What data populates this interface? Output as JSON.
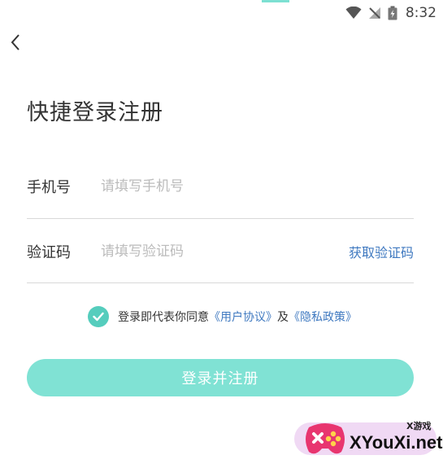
{
  "status_bar": {
    "time": "8:32",
    "icons": [
      "wifi-icon",
      "no-signal-icon",
      "battery-charging-icon"
    ],
    "accent_color": "#7de0d2"
  },
  "nav": {
    "back_icon": "chevron-left-icon"
  },
  "page": {
    "title": "快捷登录注册"
  },
  "form": {
    "phone": {
      "label": "手机号",
      "placeholder": "请填写手机号",
      "value": ""
    },
    "code": {
      "label": "验证码",
      "placeholder": "请填写验证码",
      "value": "",
      "get_code_label": "获取验证码"
    }
  },
  "agreement": {
    "checked": true,
    "text": "登录即代表你同意",
    "user_agreement": "《用户协议》",
    "conjunction": "及",
    "privacy_policy": "《隐私政策》"
  },
  "submit": {
    "label": "登录并注册"
  },
  "watermark": {
    "site": "XYouXi.net",
    "tag": "X游戏"
  },
  "colors": {
    "accent": "#80e2d4",
    "check": "#55cdbd",
    "link": "#3f79c0",
    "placeholder": "#bbbbbb",
    "divider": "#d9d9d9"
  }
}
